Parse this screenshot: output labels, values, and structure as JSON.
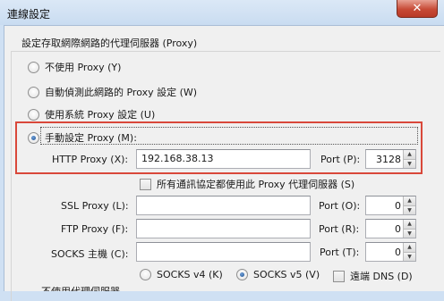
{
  "window": {
    "title": "連線設定",
    "close_glyph": "✕"
  },
  "section_label": "設定存取網際網路的代理伺服器 (Proxy)",
  "options": {
    "no_proxy": "不使用 Proxy (Y)",
    "auto_detect": "自動偵測此網路的 Proxy 設定 (W)",
    "system_proxy": "使用系統 Proxy 設定 (U)",
    "manual_proxy": "手動設定 Proxy (M):"
  },
  "selected_option": "manual_proxy",
  "http": {
    "label": "HTTP Proxy (X):",
    "value": "192.168.38.13",
    "port_label": "Port (P):",
    "port_value": "3128"
  },
  "share_all": {
    "label": "所有通訊協定都使用此 Proxy 代理伺服器 (S)",
    "checked": false
  },
  "ssl": {
    "label": "SSL Proxy (L):",
    "value": "",
    "port_label": "Port (O):",
    "port_value": "0"
  },
  "ftp": {
    "label": "FTP Proxy (F):",
    "value": "",
    "port_label": "Port (R):",
    "port_value": "0"
  },
  "socks": {
    "label": "SOCKS 主機 (C):",
    "value": "",
    "port_label": "Port (T):",
    "port_value": "0"
  },
  "socks_version": {
    "v4": "SOCKS v4 (K)",
    "v5": "SOCKS v5 (V)",
    "selected": "v5"
  },
  "remote_dns": {
    "label": "遠端 DNS (D)",
    "checked": false
  },
  "spin_up": "▲",
  "spin_down": "▼",
  "bottom_cut_text": "不使用代理伺服器"
}
